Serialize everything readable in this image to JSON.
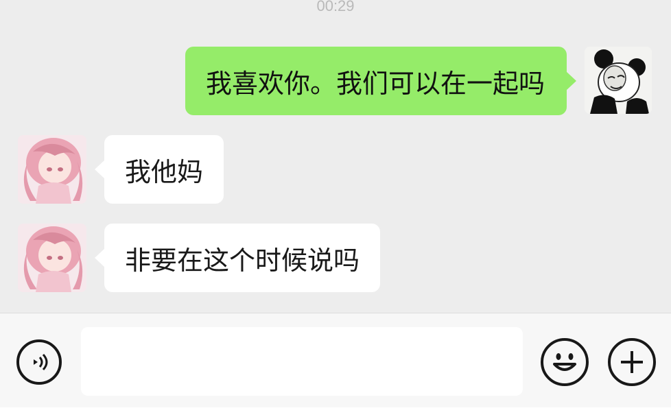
{
  "chat": {
    "timestamp": "00:29",
    "messages": [
      {
        "direction": "outgoing",
        "text": "我喜欢你。我们可以在一起吗",
        "avatar": "panda-meme-avatar"
      },
      {
        "direction": "incoming",
        "text": "我他妈",
        "avatar": "anime-girl-avatar"
      },
      {
        "direction": "incoming",
        "text": "非要在这个时候说吗",
        "avatar": "anime-girl-avatar"
      }
    ]
  },
  "input_bar": {
    "voice_icon": "voice-icon",
    "text_value": "",
    "emoji_icon": "emoji-icon",
    "plus_icon": "plus-icon"
  },
  "colors": {
    "background": "#ededed",
    "outgoing_bubble": "#95ec69",
    "incoming_bubble": "#ffffff",
    "timestamp": "#b9b9b9"
  }
}
